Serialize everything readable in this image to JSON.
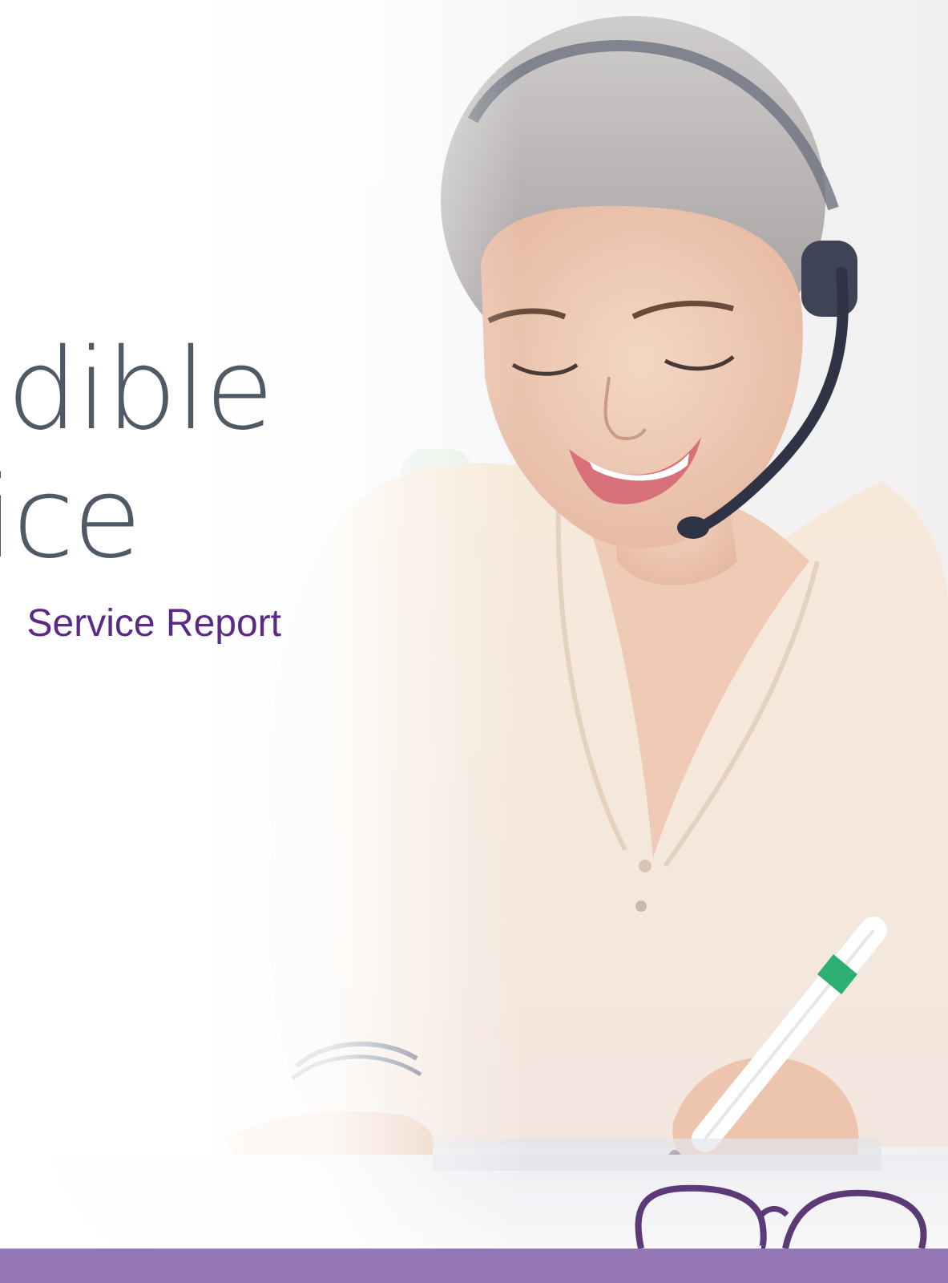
{
  "cover": {
    "title_line_1": "redible",
    "title_line_2": "vice",
    "subtitle": "Service Report"
  },
  "colors": {
    "title": "#4f5a66",
    "subtitle": "#5a2a86",
    "footer_band": "#9577b6",
    "background": "#ffffff"
  },
  "photo": {
    "icon": "customer-service-agent-photo"
  }
}
